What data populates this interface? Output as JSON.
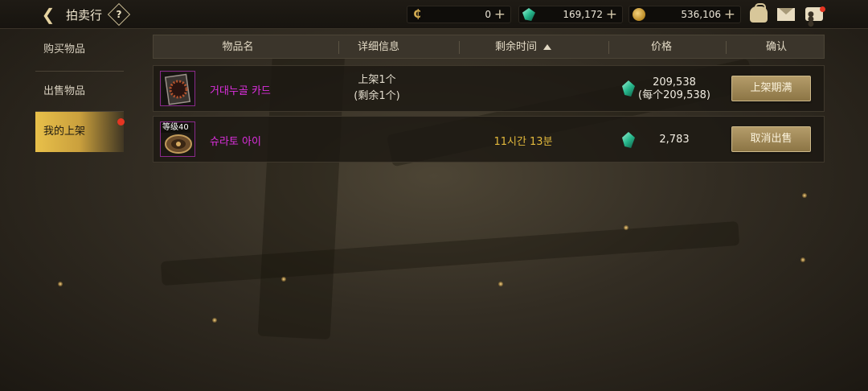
{
  "header": {
    "title": "拍卖行",
    "back_icon": "back-arrow-icon",
    "help_label": "?",
    "currencies": [
      {
        "name": "c-coin",
        "value": "0"
      },
      {
        "name": "gem",
        "value": "169,172"
      },
      {
        "name": "gold",
        "value": "536,106"
      }
    ],
    "icons": [
      "bag-icon",
      "mail-icon",
      "chat-icon"
    ]
  },
  "sidebar": {
    "items": [
      {
        "label": "购买物品"
      },
      {
        "label": "出售物品"
      },
      {
        "label": "我的上架"
      }
    ]
  },
  "table": {
    "columns": [
      "物品名",
      "详细信息",
      "剩余时间",
      "价格",
      "确认"
    ],
    "rows": [
      {
        "name": "거대누골 카드",
        "detail_line1": "上架1个",
        "detail_line2": "(剩余1个)",
        "remaining": "",
        "price_line1": "209,538",
        "price_line2": "(每个209,538)",
        "action": "上架期满"
      },
      {
        "level": "等级40",
        "name": "슈라토 아이",
        "remaining": "11시간 13분",
        "price_line1": "2,783",
        "action": "取消出售"
      }
    ]
  },
  "colors": {
    "item_name": "#de2fe0",
    "remaining": "#e3b93c",
    "active_tab": "#e8c04a",
    "notification": "#e53522"
  }
}
